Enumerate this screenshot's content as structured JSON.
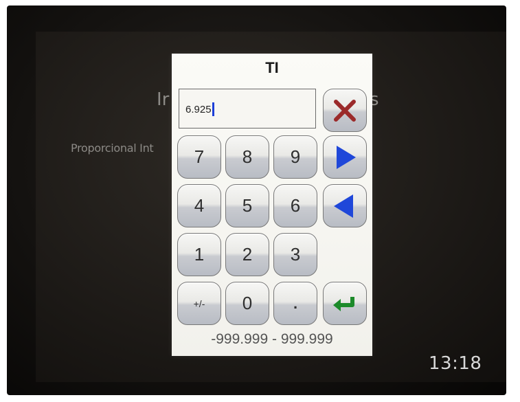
{
  "background": {
    "title_left": "Ir",
    "title_right": "s",
    "label": "Proporcional Int",
    "clock": "13:18"
  },
  "dialog": {
    "title": "TI",
    "value": "6.925",
    "range": "-999.999 - 999.999"
  },
  "keypad": {
    "k7": "7",
    "k8": "8",
    "k9": "9",
    "k4": "4",
    "k5": "5",
    "k6": "6",
    "k1": "1",
    "k2": "2",
    "k3": "3",
    "sign": "+/-",
    "k0": "0",
    "dot": "."
  },
  "icons": {
    "cancel": "close-icon",
    "right": "arrow-right-icon",
    "left": "arrow-left-icon",
    "enter": "enter-icon"
  },
  "colors": {
    "arrow": "#1f47d9",
    "cancel": "#9b2a2a",
    "enter": "#1c8a2a"
  }
}
